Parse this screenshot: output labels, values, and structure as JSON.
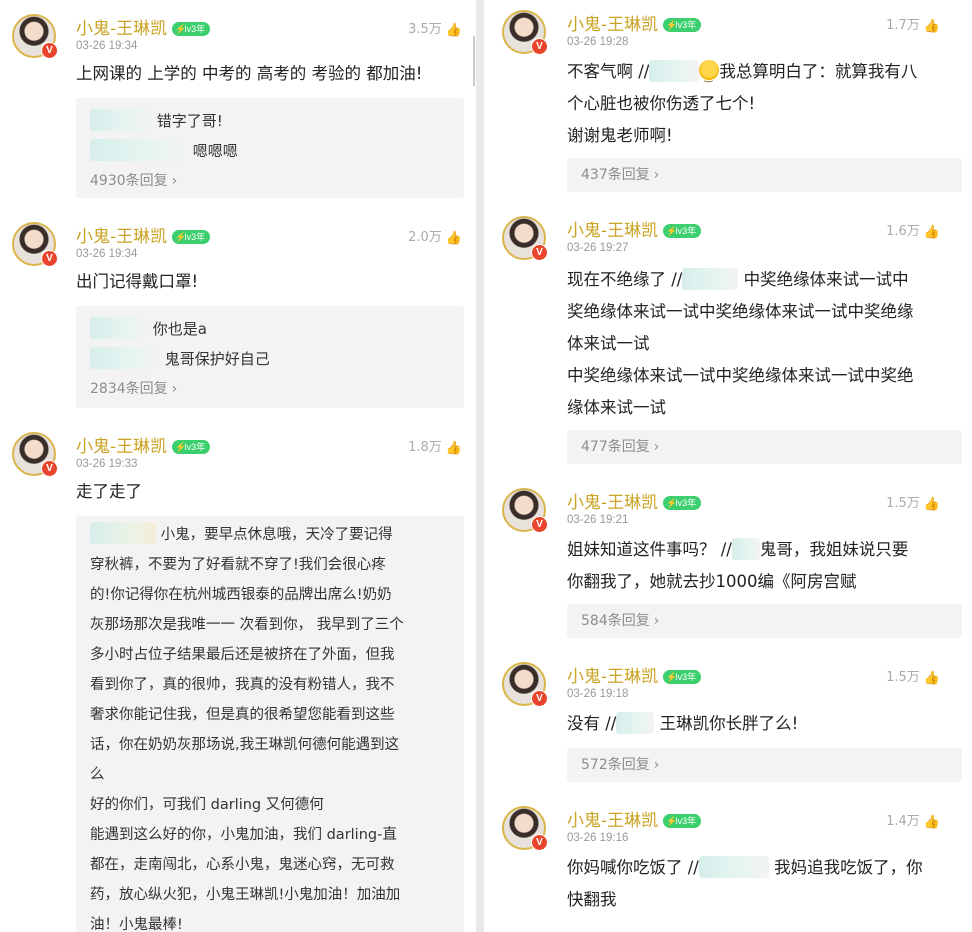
{
  "left_comments": [
    {
      "user": "小鬼-王琳凯",
      "level": "lv3年",
      "time": "03-26 19:34",
      "likes": "3.5万",
      "text": [
        "上网课的 上学的 中考的 高考的 考验的 都加油!"
      ],
      "replies": [
        "错字了哥!",
        "嗯嗯嗯"
      ],
      "more": "4930条回复"
    },
    {
      "user": "小鬼-王琳凯",
      "level": "lv3年",
      "time": "03-26 19:34",
      "likes": "2.0万",
      "text": [
        "出门记得戴口罩!"
      ],
      "replies": [
        "你也是a",
        "鬼哥保护好自己"
      ],
      "more": "2834条回复"
    },
    {
      "user": "小鬼-王琳凯",
      "level": "lv3年",
      "time": "03-26 19:33",
      "likes": "1.8万",
      "text": [
        "走了走了"
      ],
      "long_reply": [
        "小鬼，要早点休息哦，天冷了要记得",
        "穿秋裤，不要为了好看就不穿了!我们会很心疼",
        "的!你记得你在杭州城西银泰的品牌出席么!奶奶",
        "灰那场那次是我唯一一 次看到你， 我早到了三个",
        "多小时占位子结果最后还是被挤在了外面，但我",
        "看到你了，真的很帅，我真的没有粉错人，我不",
        "奢求你能记住我，但是真的很希望您能看到这些",
        "话，你在奶奶灰那场说,我王琳凯何德何能遇到这",
        "么",
        "好的你们，可我们 darling 又何德何",
        "能遇到这么好的你，小鬼加油，我们 darling-直",
        "都在，走南闯北，心系小鬼，鬼迷心窍，无可救",
        "药，放心纵火犯，小鬼王琳凯!小鬼加油！加油加",
        "油！小鬼最棒!"
      ]
    }
  ],
  "right_comments": [
    {
      "user": "小鬼-王琳凯",
      "level": "lv3年",
      "time": "03-26 19:28",
      "likes": "1.7万",
      "text": [
        "不客气啊 //",
        "我总算明白了：就算我有八",
        "个心脏也被你伤透了七个!",
        "谢谢鬼老师啊!"
      ],
      "more": "437条回复"
    },
    {
      "user": "小鬼-王琳凯",
      "level": "lv3年",
      "time": "03-26 19:27",
      "likes": "1.6万",
      "text": [
        "现在不绝缘了 //",
        "中奖绝缘体来试一试中",
        "奖绝缘体来试一试中奖绝缘体来试一试中奖绝缘",
        "体来试一试",
        "中奖绝缘体来试一试中奖绝缘体来试一试中奖绝",
        "缘体来试一试"
      ],
      "more": "477条回复"
    },
    {
      "user": "小鬼-王琳凯",
      "level": "lv3年",
      "time": "03-26 19:21",
      "likes": "1.5万",
      "text": [
        "姐妹知道这件事吗？ //",
        "鬼哥，我姐妹说只要",
        "你翻我了，她就去抄1000编《阿房宫赋"
      ],
      "more": "584条回复"
    },
    {
      "user": "小鬼-王琳凯",
      "level": "lv3年",
      "time": "03-26 19:18",
      "likes": "1.5万",
      "text": [
        "没有 //",
        "王琳凯你长胖了么!"
      ],
      "more": "572条回复"
    },
    {
      "user": "小鬼-王琳凯",
      "level": "lv3年",
      "time": "03-26 19:16",
      "likes": "1.4万",
      "text": [
        "你妈喊你吃饭了 //",
        "我妈追我吃饭了，你",
        "快翻我"
      ]
    }
  ],
  "icons": {
    "thumb": "thumbs-up-icon",
    "verified": "verified-v-icon",
    "level": "level-badge-icon",
    "chevron": "chevron-right-icon"
  },
  "glyphs": {
    "thumb": "👍",
    "verified": "V",
    "chevron": "›"
  },
  "colors": {
    "username": "#c9a323",
    "level_badge": "#3ccf6d",
    "verified": "#e8452c",
    "reply_bg": "#f3f3f3"
  }
}
